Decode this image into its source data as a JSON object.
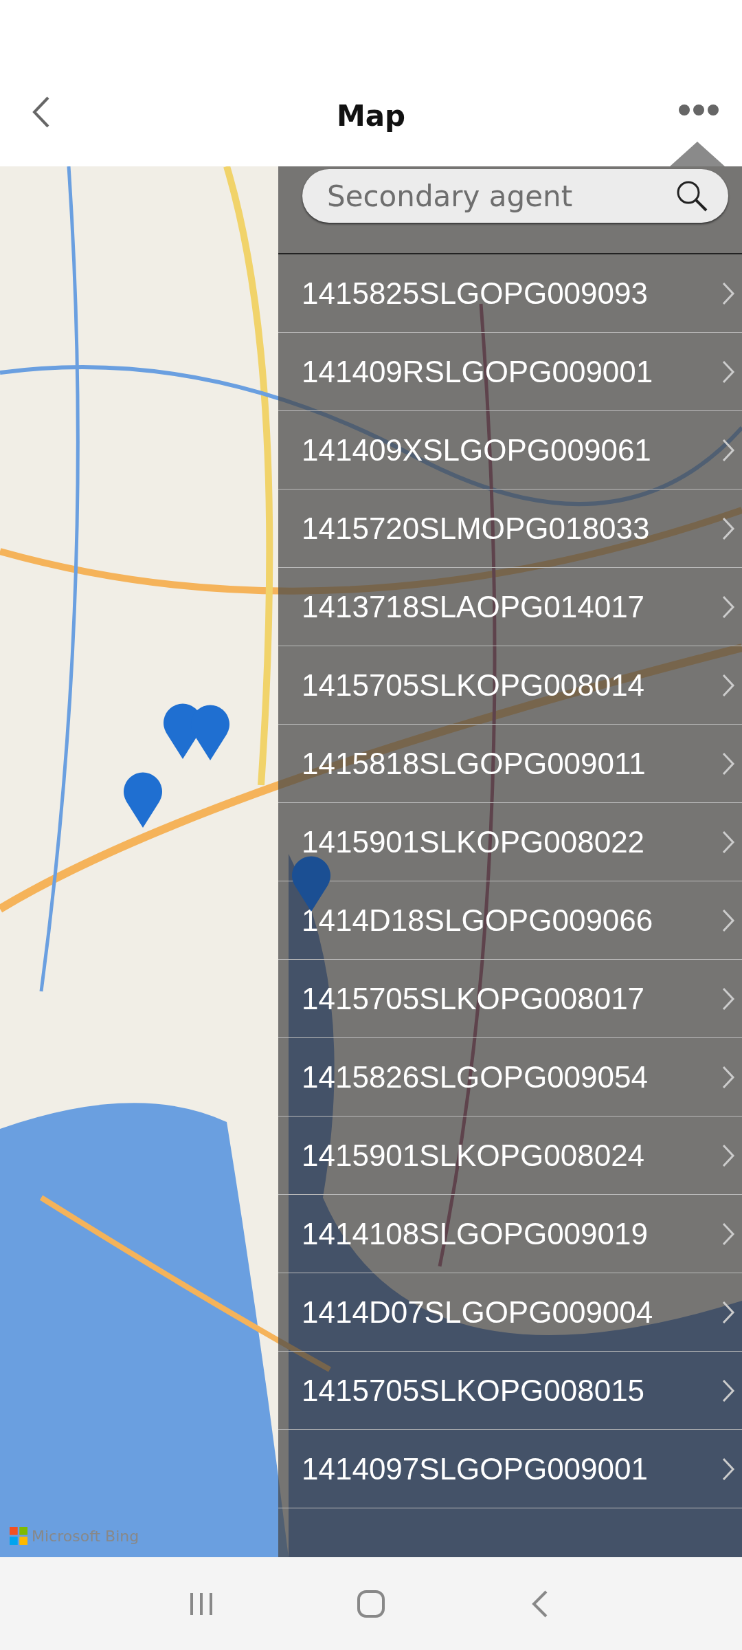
{
  "header": {
    "title": "Map"
  },
  "search": {
    "placeholder": "Secondary agent"
  },
  "agents": [
    {
      "code": "1415825SLGOPG009093"
    },
    {
      "code": "141409RSLGOPG009001"
    },
    {
      "code": "141409XSLGOPG009061"
    },
    {
      "code": "1415720SLMOPG018033"
    },
    {
      "code": "1413718SLAOPG014017"
    },
    {
      "code": "1415705SLKOPG008014"
    },
    {
      "code": "1415818SLGOPG009011"
    },
    {
      "code": "1415901SLKOPG008022"
    },
    {
      "code": "1414D18SLGOPG009066"
    },
    {
      "code": "1415705SLKOPG008017"
    },
    {
      "code": "1415826SLGOPG009054"
    },
    {
      "code": "1415901SLKOPG008024"
    },
    {
      "code": "1414108SLGOPG009019"
    },
    {
      "code": "1414D07SLGOPG009004"
    },
    {
      "code": "1415705SLKOPG008015"
    },
    {
      "code": "1414097SLGOPG009001"
    }
  ],
  "map": {
    "attribution": "Microsoft Bing"
  }
}
